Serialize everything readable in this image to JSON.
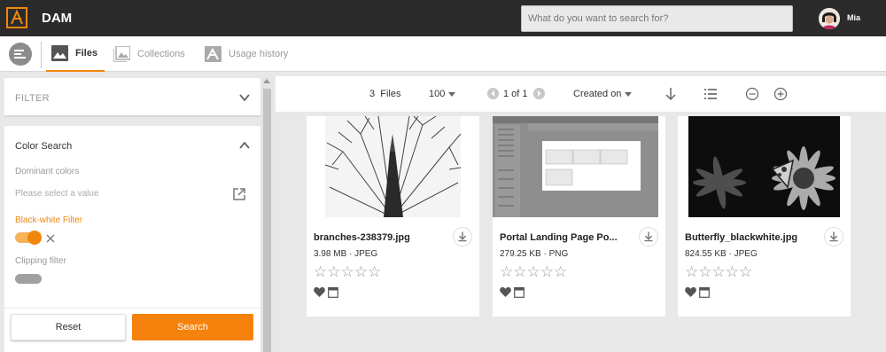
{
  "topbar": {
    "app_title": "DAM",
    "search_placeholder": "What do you want to search for?",
    "user_name": "Mia"
  },
  "nav": {
    "tabs": [
      {
        "label": "Files",
        "active": true
      },
      {
        "label": "Collections",
        "active": false
      },
      {
        "label": "Usage history",
        "active": false
      }
    ]
  },
  "filter": {
    "title": "FILTER",
    "color_search": {
      "title": "Color Search",
      "dominant_label": "Dominant colors",
      "dominant_placeholder": "Please select a value",
      "bw_label": "Black-white Filter",
      "bw_enabled": true,
      "clipping_label": "Clipping filter",
      "clipping_enabled": false
    },
    "reset_label": "Reset",
    "search_label": "Search"
  },
  "toolbar": {
    "file_count": "3",
    "files_label": "Files",
    "per_page": "100",
    "pagination": "1 of 1",
    "sort": "Created on"
  },
  "cards": [
    {
      "name": "branches-238379.jpg",
      "size": "3.98 MB",
      "format": "JPEG",
      "rating": 0
    },
    {
      "name": "Portal Landing Page Po...",
      "size": "279.25 KB",
      "format": "PNG",
      "rating": 0
    },
    {
      "name": "Butterfly_blackwhite.jpg",
      "size": "824.55 KB",
      "format": "JPEG",
      "rating": 0
    }
  ],
  "colors": {
    "accent": "#f0870c",
    "topbar": "#2b2b2b"
  }
}
